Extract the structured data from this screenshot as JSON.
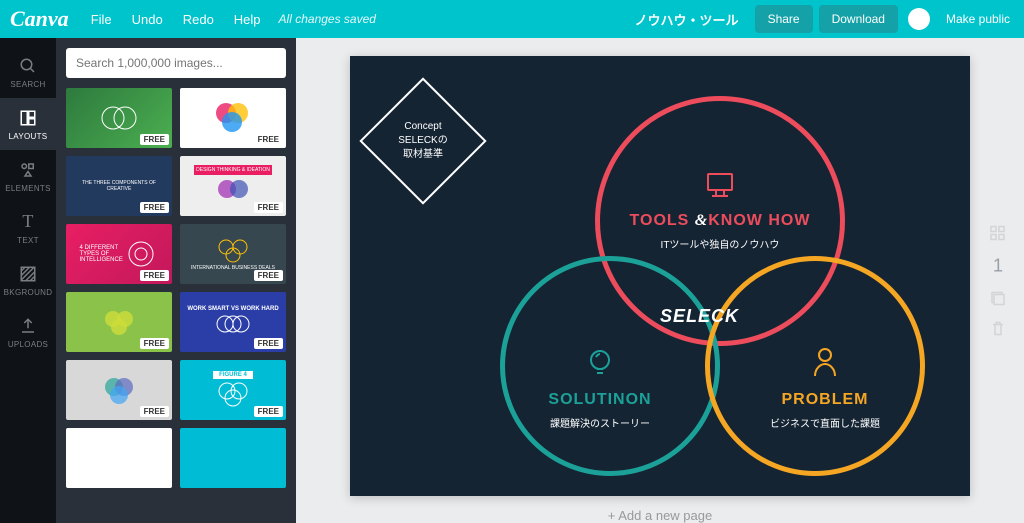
{
  "brand": "Canva",
  "menu": {
    "file": "File",
    "undo": "Undo",
    "redo": "Redo",
    "help": "Help"
  },
  "status": "All changes saved",
  "docname": "ノウハウ・ツール",
  "buttons": {
    "share": "Share",
    "download": "Download",
    "public": "Make public"
  },
  "sidebar": {
    "search": "SEARCH",
    "layouts": "LAYOUTS",
    "elements": "ELEMENTS",
    "text": "TEXT",
    "bkground": "BKGROUND",
    "uploads": "UPLOADS"
  },
  "search": {
    "placeholder": "Search 1,000,000 images..."
  },
  "badge": "FREE",
  "thumbs": {
    "t3": "THE THREE COMPONENTS OF CREATIVE",
    "t4": "DESIGN THINKING & IDEATION",
    "t5": "4 DIFFERENT TYPES OF INTELLIGENCE",
    "t6": "INTERNATIONAL BUSINESS DEALS",
    "t8": "WORK SMART VS WORK HARD",
    "t10": "FIGURE 4"
  },
  "slide": {
    "diamond": {
      "l1": "Concept",
      "l2": "SELECKの",
      "l3": "取材基準"
    },
    "c1": {
      "title": "TOOLS ",
      "amp": "&",
      "title2": "KNOW HOW",
      "sub": "ITツールや独自のノウハウ"
    },
    "c2": {
      "title": "SOLUTINON",
      "sub": "課題解決のストーリー"
    },
    "c3": {
      "title": "PROBLEM",
      "sub": "ビジネスで直面した課題"
    },
    "center": "SELECK"
  },
  "addpage": "+ Add a new page",
  "pagenum": "1"
}
